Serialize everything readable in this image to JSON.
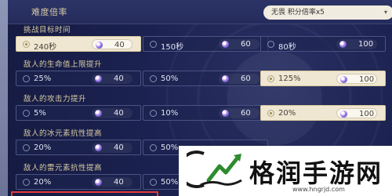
{
  "header": {
    "title": "难度倍率",
    "select_value": "无畏  积分倍率x5",
    "select_icon": "chevron-down-icon"
  },
  "sections": [
    {
      "title": "挑战目标时间",
      "options": [
        {
          "value": "240秒",
          "points": "40",
          "selected": true
        },
        {
          "value": "150秒",
          "points": "60",
          "selected": false
        },
        {
          "value": "80秒",
          "points": "100",
          "selected": false
        }
      ]
    },
    {
      "title": "敌人的生命值上限提升",
      "options": [
        {
          "value": "25%",
          "points": "40",
          "selected": false
        },
        {
          "value": "50%",
          "points": "60",
          "selected": false
        },
        {
          "value": "125%",
          "points": "100",
          "selected": true
        }
      ]
    },
    {
      "title": "敌人的攻击力提升",
      "options": [
        {
          "value": "5%",
          "points": "40",
          "selected": false
        },
        {
          "value": "10%",
          "points": "60",
          "selected": false
        },
        {
          "value": "20%",
          "points": "100",
          "selected": true
        }
      ]
    },
    {
      "title": "敌人的冰元素抗性提高",
      "options": [
        {
          "value": "20%",
          "points": "40",
          "selected": false
        },
        {
          "value": "50%",
          "points": "",
          "selected": false
        }
      ]
    },
    {
      "title": "敌人的雷元素抗性提高",
      "options": [
        {
          "value": "20%",
          "points": "40",
          "selected": false
        },
        {
          "value": "50%",
          "points": "",
          "selected": false
        }
      ]
    }
  ],
  "watermark": {
    "text": "格润手游网",
    "url": "www.hngrjd.com"
  },
  "colors": {
    "selected_bg": "#efe7d2",
    "panel_bg": "#1d2350",
    "highlight": "#e33b3b",
    "logo_green": "#2e8b2e"
  }
}
